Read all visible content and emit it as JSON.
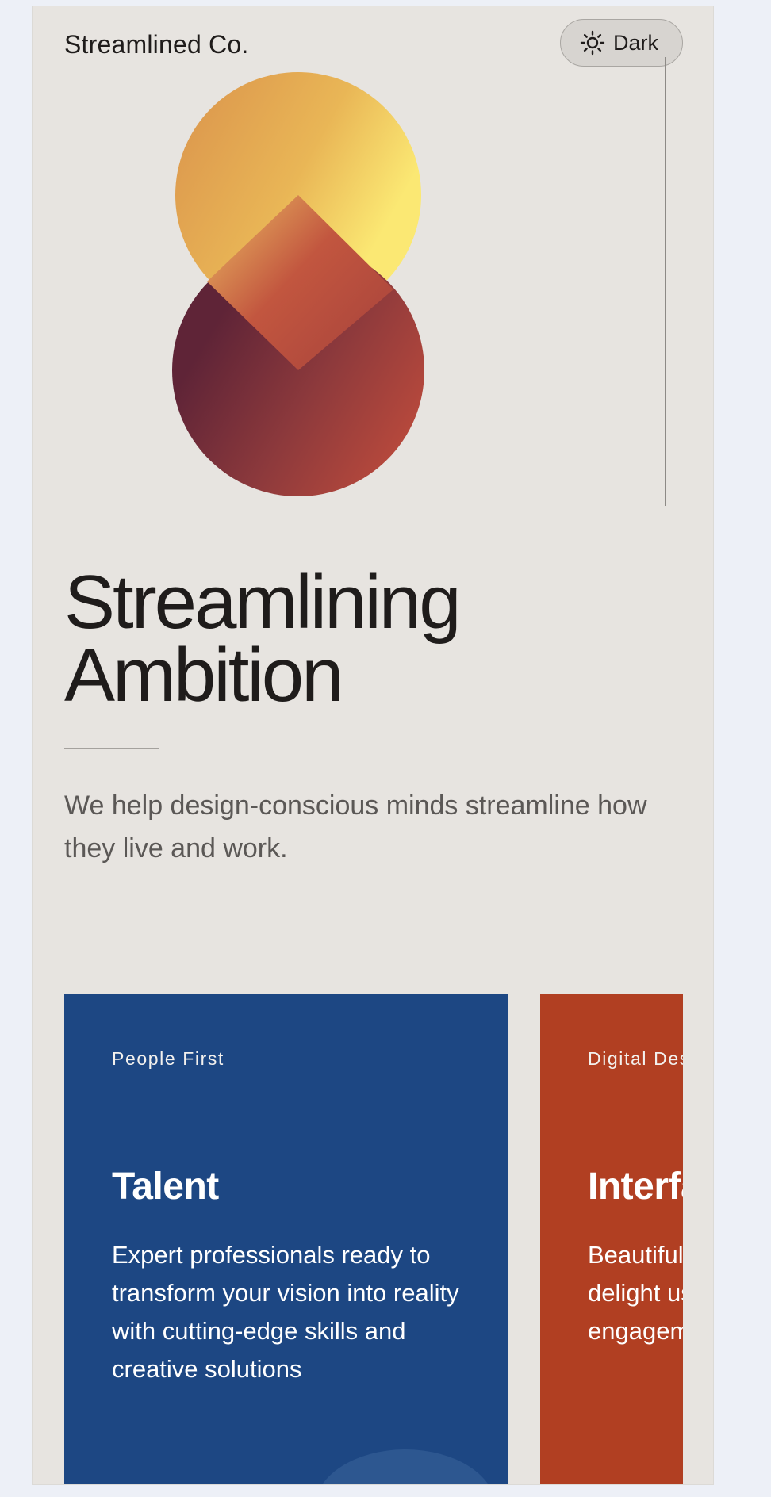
{
  "header": {
    "brand": "Streamlined Co.",
    "theme_toggle": {
      "icon": "sun-icon",
      "label": "Dark"
    }
  },
  "hero": {
    "logo": "gradient-s-logo",
    "title_line1": "Streamlining",
    "title_line2": "Ambition",
    "tagline": "We help design-conscious minds streamline how they live and work."
  },
  "cards": [
    {
      "eyebrow": "People First",
      "title": "Talent",
      "body": "Expert professionals ready to transform your vision into reality with cutting-edge skills and creative solutions",
      "color": "#1d4783"
    },
    {
      "eyebrow": "Digital Design",
      "title": "Interfaces",
      "body": "Beautiful digital experiences that delight users and drive engagement",
      "color": "#b13f22"
    }
  ],
  "colors": {
    "page_bg": "#e7e4e0",
    "text": "#1f1c1b",
    "muted_text": "#5b5856",
    "logo_gradient": [
      "#fbe873",
      "#e3a450",
      "#b54d3c",
      "#6a2838"
    ]
  }
}
